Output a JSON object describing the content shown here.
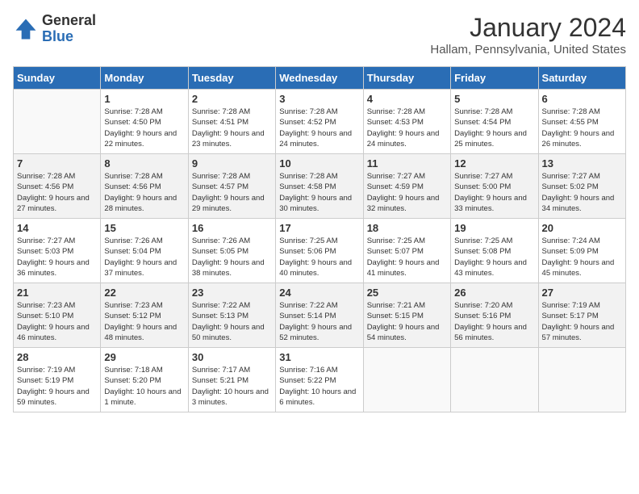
{
  "header": {
    "logo_general": "General",
    "logo_blue": "Blue",
    "month_title": "January 2024",
    "location": "Hallam, Pennsylvania, United States"
  },
  "days_of_week": [
    "Sunday",
    "Monday",
    "Tuesday",
    "Wednesday",
    "Thursday",
    "Friday",
    "Saturday"
  ],
  "weeks": [
    [
      {
        "day": "",
        "sunrise": "",
        "sunset": "",
        "daylight": ""
      },
      {
        "day": "1",
        "sunrise": "Sunrise: 7:28 AM",
        "sunset": "Sunset: 4:50 PM",
        "daylight": "Daylight: 9 hours and 22 minutes."
      },
      {
        "day": "2",
        "sunrise": "Sunrise: 7:28 AM",
        "sunset": "Sunset: 4:51 PM",
        "daylight": "Daylight: 9 hours and 23 minutes."
      },
      {
        "day": "3",
        "sunrise": "Sunrise: 7:28 AM",
        "sunset": "Sunset: 4:52 PM",
        "daylight": "Daylight: 9 hours and 24 minutes."
      },
      {
        "day": "4",
        "sunrise": "Sunrise: 7:28 AM",
        "sunset": "Sunset: 4:53 PM",
        "daylight": "Daylight: 9 hours and 24 minutes."
      },
      {
        "day": "5",
        "sunrise": "Sunrise: 7:28 AM",
        "sunset": "Sunset: 4:54 PM",
        "daylight": "Daylight: 9 hours and 25 minutes."
      },
      {
        "day": "6",
        "sunrise": "Sunrise: 7:28 AM",
        "sunset": "Sunset: 4:55 PM",
        "daylight": "Daylight: 9 hours and 26 minutes."
      }
    ],
    [
      {
        "day": "7",
        "sunrise": "Sunrise: 7:28 AM",
        "sunset": "Sunset: 4:56 PM",
        "daylight": "Daylight: 9 hours and 27 minutes."
      },
      {
        "day": "8",
        "sunrise": "Sunrise: 7:28 AM",
        "sunset": "Sunset: 4:56 PM",
        "daylight": "Daylight: 9 hours and 28 minutes."
      },
      {
        "day": "9",
        "sunrise": "Sunrise: 7:28 AM",
        "sunset": "Sunset: 4:57 PM",
        "daylight": "Daylight: 9 hours and 29 minutes."
      },
      {
        "day": "10",
        "sunrise": "Sunrise: 7:28 AM",
        "sunset": "Sunset: 4:58 PM",
        "daylight": "Daylight: 9 hours and 30 minutes."
      },
      {
        "day": "11",
        "sunrise": "Sunrise: 7:27 AM",
        "sunset": "Sunset: 4:59 PM",
        "daylight": "Daylight: 9 hours and 32 minutes."
      },
      {
        "day": "12",
        "sunrise": "Sunrise: 7:27 AM",
        "sunset": "Sunset: 5:00 PM",
        "daylight": "Daylight: 9 hours and 33 minutes."
      },
      {
        "day": "13",
        "sunrise": "Sunrise: 7:27 AM",
        "sunset": "Sunset: 5:02 PM",
        "daylight": "Daylight: 9 hours and 34 minutes."
      }
    ],
    [
      {
        "day": "14",
        "sunrise": "Sunrise: 7:27 AM",
        "sunset": "Sunset: 5:03 PM",
        "daylight": "Daylight: 9 hours and 36 minutes."
      },
      {
        "day": "15",
        "sunrise": "Sunrise: 7:26 AM",
        "sunset": "Sunset: 5:04 PM",
        "daylight": "Daylight: 9 hours and 37 minutes."
      },
      {
        "day": "16",
        "sunrise": "Sunrise: 7:26 AM",
        "sunset": "Sunset: 5:05 PM",
        "daylight": "Daylight: 9 hours and 38 minutes."
      },
      {
        "day": "17",
        "sunrise": "Sunrise: 7:25 AM",
        "sunset": "Sunset: 5:06 PM",
        "daylight": "Daylight: 9 hours and 40 minutes."
      },
      {
        "day": "18",
        "sunrise": "Sunrise: 7:25 AM",
        "sunset": "Sunset: 5:07 PM",
        "daylight": "Daylight: 9 hours and 41 minutes."
      },
      {
        "day": "19",
        "sunrise": "Sunrise: 7:25 AM",
        "sunset": "Sunset: 5:08 PM",
        "daylight": "Daylight: 9 hours and 43 minutes."
      },
      {
        "day": "20",
        "sunrise": "Sunrise: 7:24 AM",
        "sunset": "Sunset: 5:09 PM",
        "daylight": "Daylight: 9 hours and 45 minutes."
      }
    ],
    [
      {
        "day": "21",
        "sunrise": "Sunrise: 7:23 AM",
        "sunset": "Sunset: 5:10 PM",
        "daylight": "Daylight: 9 hours and 46 minutes."
      },
      {
        "day": "22",
        "sunrise": "Sunrise: 7:23 AM",
        "sunset": "Sunset: 5:12 PM",
        "daylight": "Daylight: 9 hours and 48 minutes."
      },
      {
        "day": "23",
        "sunrise": "Sunrise: 7:22 AM",
        "sunset": "Sunset: 5:13 PM",
        "daylight": "Daylight: 9 hours and 50 minutes."
      },
      {
        "day": "24",
        "sunrise": "Sunrise: 7:22 AM",
        "sunset": "Sunset: 5:14 PM",
        "daylight": "Daylight: 9 hours and 52 minutes."
      },
      {
        "day": "25",
        "sunrise": "Sunrise: 7:21 AM",
        "sunset": "Sunset: 5:15 PM",
        "daylight": "Daylight: 9 hours and 54 minutes."
      },
      {
        "day": "26",
        "sunrise": "Sunrise: 7:20 AM",
        "sunset": "Sunset: 5:16 PM",
        "daylight": "Daylight: 9 hours and 56 minutes."
      },
      {
        "day": "27",
        "sunrise": "Sunrise: 7:19 AM",
        "sunset": "Sunset: 5:17 PM",
        "daylight": "Daylight: 9 hours and 57 minutes."
      }
    ],
    [
      {
        "day": "28",
        "sunrise": "Sunrise: 7:19 AM",
        "sunset": "Sunset: 5:19 PM",
        "daylight": "Daylight: 9 hours and 59 minutes."
      },
      {
        "day": "29",
        "sunrise": "Sunrise: 7:18 AM",
        "sunset": "Sunset: 5:20 PM",
        "daylight": "Daylight: 10 hours and 1 minute."
      },
      {
        "day": "30",
        "sunrise": "Sunrise: 7:17 AM",
        "sunset": "Sunset: 5:21 PM",
        "daylight": "Daylight: 10 hours and 3 minutes."
      },
      {
        "day": "31",
        "sunrise": "Sunrise: 7:16 AM",
        "sunset": "Sunset: 5:22 PM",
        "daylight": "Daylight: 10 hours and 6 minutes."
      },
      {
        "day": "",
        "sunrise": "",
        "sunset": "",
        "daylight": ""
      },
      {
        "day": "",
        "sunrise": "",
        "sunset": "",
        "daylight": ""
      },
      {
        "day": "",
        "sunrise": "",
        "sunset": "",
        "daylight": ""
      }
    ]
  ]
}
